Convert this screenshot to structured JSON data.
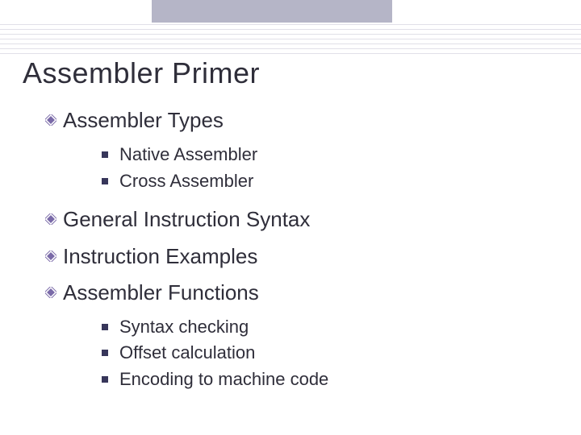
{
  "title": "Assembler Primer",
  "bullets": [
    {
      "label": "Assembler Types",
      "children": [
        {
          "label": "Native Assembler"
        },
        {
          "label": "Cross Assembler"
        }
      ]
    },
    {
      "label": "General Instruction Syntax",
      "children": []
    },
    {
      "label": "Instruction Examples",
      "children": []
    },
    {
      "label": "Assembler Functions",
      "children": [
        {
          "label": "Syntax checking"
        },
        {
          "label": "Offset calculation"
        },
        {
          "label": "Encoding to machine code"
        }
      ]
    }
  ]
}
